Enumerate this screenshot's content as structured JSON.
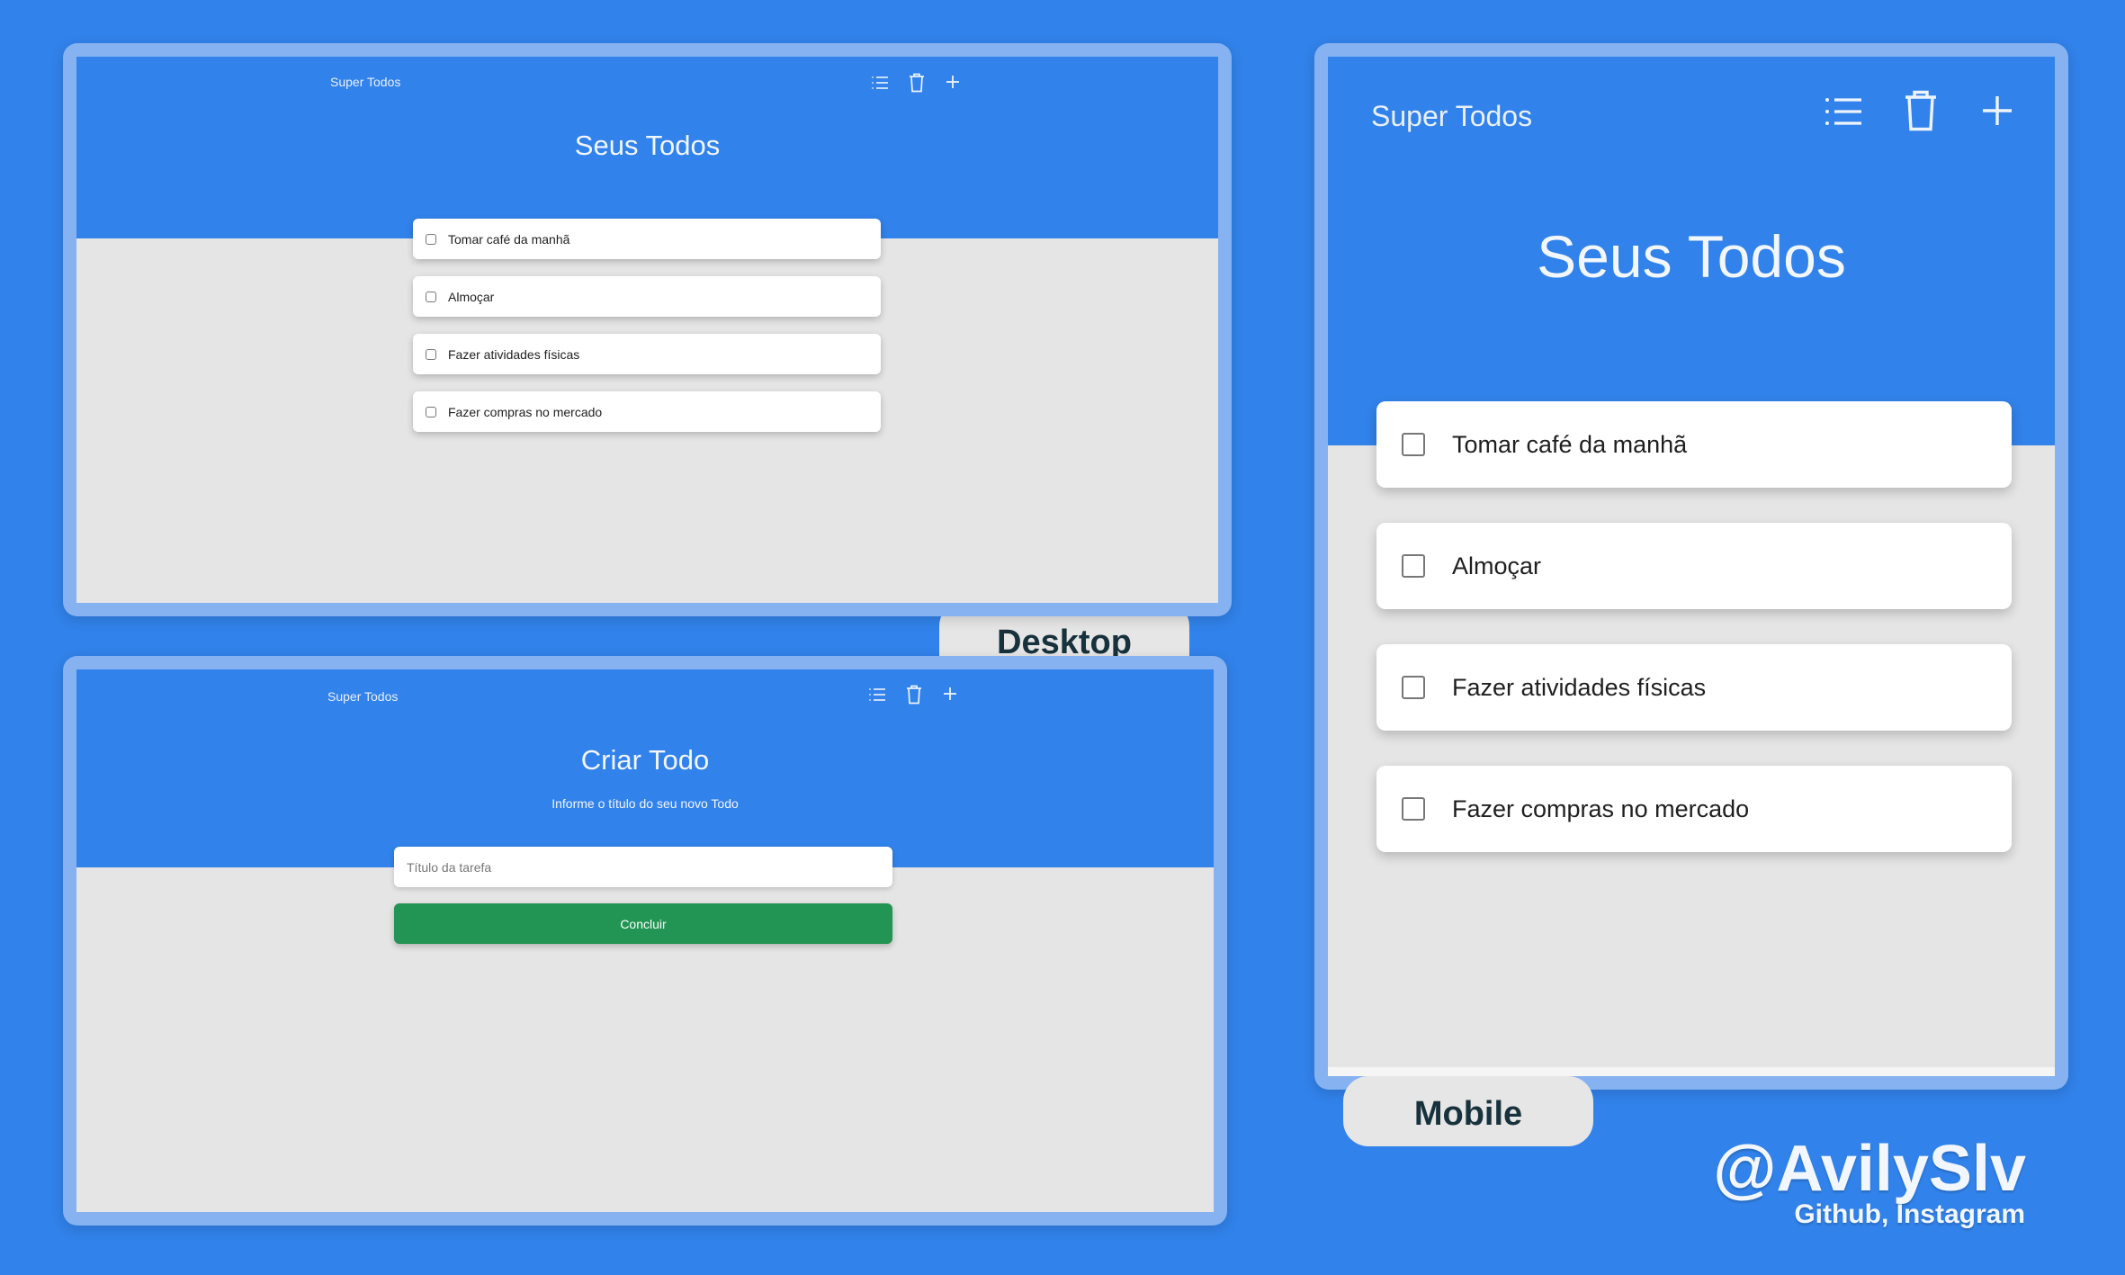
{
  "desktop_list": {
    "app_title": "Super Todos",
    "heading": "Seus Todos",
    "toolbar": {
      "list_icon": "list-icon",
      "delete_icon": "trash-icon",
      "add_icon": "plus-icon"
    },
    "items": [
      {
        "label": "Tomar café da manhã",
        "checked": false
      },
      {
        "label": "Almoçar",
        "checked": false
      },
      {
        "label": "Fazer atividades físicas",
        "checked": false
      },
      {
        "label": "Fazer compras no mercado",
        "checked": false
      }
    ]
  },
  "desktop_create": {
    "app_title": "Super Todos",
    "heading": "Criar Todo",
    "subheading": "Informe o título do seu novo Todo",
    "input_placeholder": "Título da tarefa",
    "submit_label": "Concluir"
  },
  "mobile_list": {
    "app_title": "Super Todos",
    "heading": "Seus Todos",
    "items": [
      {
        "label": "Tomar café da manhã",
        "checked": false
      },
      {
        "label": "Almoçar",
        "checked": false
      },
      {
        "label": "Fazer atividades físicas",
        "checked": false
      },
      {
        "label": "Fazer compras no mercado",
        "checked": false
      }
    ]
  },
  "labels": {
    "desktop": "Desktop",
    "mobile": "Mobile"
  },
  "credit": {
    "handle": "@AvilySlv",
    "platforms": "Github, Instagram"
  },
  "colors": {
    "background": "#3182ea",
    "primary": "#3182ea",
    "success": "#229453",
    "surface": "#e5e5e5"
  }
}
